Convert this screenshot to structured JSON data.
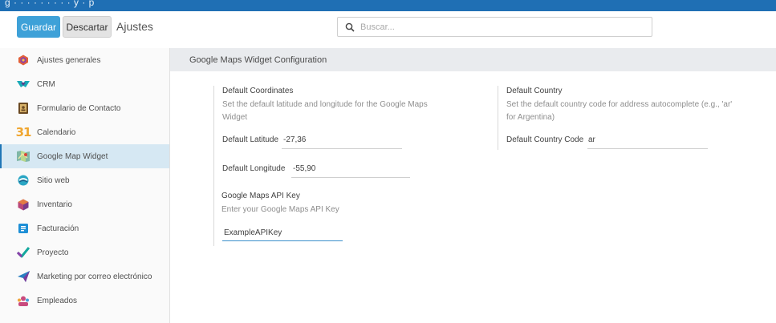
{
  "topbar": {
    "fragment": "g  ·  ·  ·  ·  ·  ·  ·  ·  ·  y  ·  p"
  },
  "controls": {
    "save": "Guardar",
    "discard": "Descartar",
    "title": "Ajustes"
  },
  "search": {
    "placeholder": "Buscar..."
  },
  "sidebar": {
    "items": [
      {
        "label": "Ajustes generales",
        "icon": "settings-hex-icon"
      },
      {
        "label": "CRM",
        "icon": "crm-handshake-icon"
      },
      {
        "label": "Formulario de Contacto",
        "icon": "contact-form-icon"
      },
      {
        "label": "Calendario",
        "icon": "calendar-31-icon"
      },
      {
        "label": "Google Map Widget",
        "icon": "map-icon"
      },
      {
        "label": "Sitio web",
        "icon": "website-icon"
      },
      {
        "label": "Inventario",
        "icon": "inventory-box-icon"
      },
      {
        "label": "Facturación",
        "icon": "invoice-icon"
      },
      {
        "label": "Proyecto",
        "icon": "project-check-icon"
      },
      {
        "label": "Marketing por correo electrónico",
        "icon": "email-marketing-icon"
      },
      {
        "label": "Empleados",
        "icon": "employees-icon"
      }
    ],
    "active_index": 4
  },
  "section": {
    "title": "Google Maps Widget Configuration"
  },
  "coords": {
    "title": "Default Coordinates",
    "desc_line1": "Set the default latitude and longitude for the Google Maps",
    "desc_line2": "Widget",
    "lat_label": "Default Latitude",
    "lat_value": "-27,36",
    "lng_label": "Default Longitude",
    "lng_value": "-55,90"
  },
  "country": {
    "title": "Default Country",
    "desc_line1": "Set the default country code for address autocomplete (e.g., 'ar'",
    "desc_line2": "for Argentina)",
    "code_label": "Default Country Code",
    "code_value": "ar"
  },
  "apikey": {
    "title": "Google Maps API Key",
    "desc": "Enter your Google Maps API Key",
    "value": "ExampleAPIKey"
  },
  "colors": {
    "topbar": "#1f6fb4",
    "primary_button": "#3ea1d8",
    "active_item": "#d6e8f3",
    "focus_line": "#3b8fcb"
  }
}
